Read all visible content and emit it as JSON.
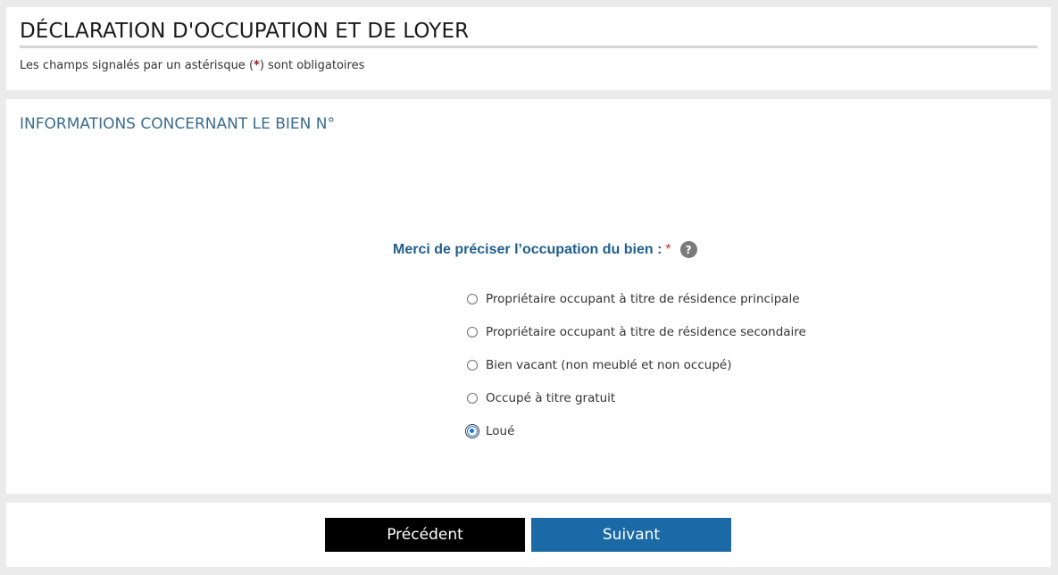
{
  "header": {
    "title": "DÉCLARATION D'OCCUPATION ET DE LOYER",
    "required_note_prefix": "Les champs signalés par un astérisque (",
    "required_note_asterisk": "*",
    "required_note_suffix": ") sont obligatoires"
  },
  "section": {
    "title": "INFORMATIONS CONCERNANT LE BIEN N°"
  },
  "question": {
    "label": "Merci de préciser l’occupation du bien :",
    "required_mark": "*",
    "help_icon": "?"
  },
  "options": [
    {
      "label": "Propriétaire occupant à titre de résidence principale",
      "checked": false
    },
    {
      "label": "Propriétaire occupant à titre de résidence secondaire",
      "checked": false
    },
    {
      "label": "Bien vacant (non meublé et non occupé)",
      "checked": false
    },
    {
      "label": "Occupé à titre gratuit",
      "checked": false
    },
    {
      "label": "Loué",
      "checked": true
    }
  ],
  "footer": {
    "prev_label": "Précédent",
    "next_label": "Suivant"
  },
  "colors": {
    "section_title": "#3a6c8e",
    "question": "#1f5f8c",
    "next_button": "#1b6aa5",
    "prev_button": "#000000",
    "required_asterisk": "#8b1c1c"
  }
}
